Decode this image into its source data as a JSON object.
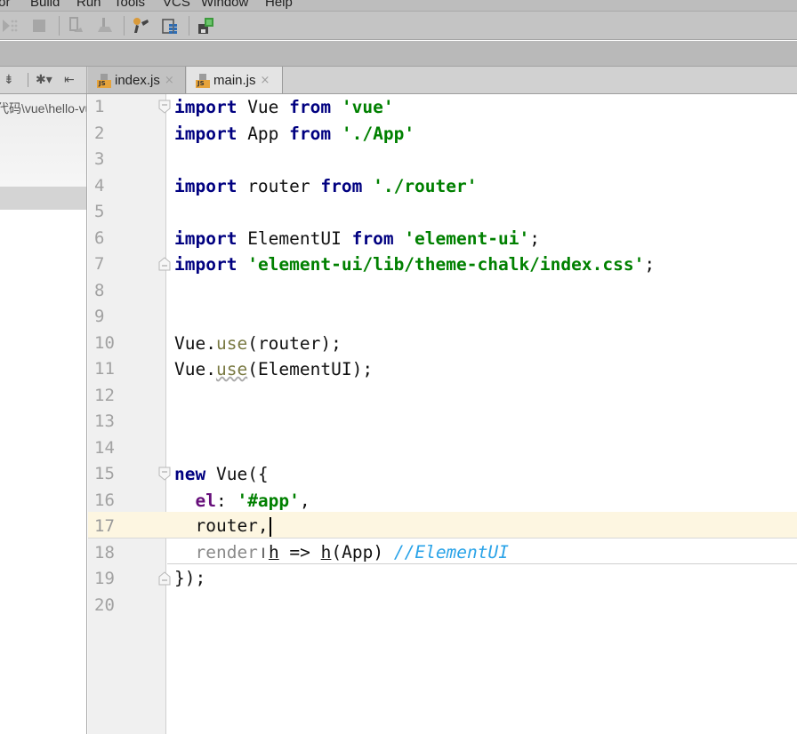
{
  "menubar": {
    "items": [
      {
        "label": "tor",
        "mnemonic": ""
      },
      {
        "label": "Build",
        "mnemonic": "B"
      },
      {
        "label": "Run",
        "mnemonic": "u"
      },
      {
        "label": "Tools",
        "mnemonic": "T"
      },
      {
        "label": "VCS",
        "mnemonic": "S"
      },
      {
        "label": "Window",
        "mnemonic": "W"
      },
      {
        "label": "Help",
        "mnemonic": "H"
      }
    ]
  },
  "toolbar": {
    "icons": [
      "debug-icon",
      "stop-icon",
      "attach-icon",
      "deploy-icon",
      "settings-wrench-icon",
      "project-structure-icon",
      "sdk-manager-icon"
    ]
  },
  "panel_tools": {
    "icons": [
      "collapse-all-icon",
      "gear-icon",
      "hide-panel-icon"
    ]
  },
  "tabs": [
    {
      "label": "index.js",
      "close": "×",
      "active": false,
      "file_type": "JS"
    },
    {
      "label": "main.js",
      "close": "×",
      "active": true,
      "file_type": "JS"
    }
  ],
  "project": {
    "path": "代码\\vue\\hello-vue"
  },
  "editor": {
    "current_line": 17,
    "line_numbers": [
      "1",
      "2",
      "3",
      "4",
      "5",
      "6",
      "7",
      "8",
      "9",
      "10",
      "11",
      "12",
      "13",
      "14",
      "15",
      "16",
      "17",
      "18",
      "19",
      "20"
    ],
    "lines": {
      "l1": {
        "kw1": "import",
        "t1": " Vue ",
        "kw2": "from",
        "sp": " ",
        "s1": "'vue'"
      },
      "l2": {
        "kw1": "import",
        "t1": " App ",
        "kw2": "from",
        "sp": " ",
        "s1": "'./App'"
      },
      "l4": {
        "kw1": "import",
        "t1": " router ",
        "kw2": "from",
        "sp": " ",
        "s1": "'./router'"
      },
      "l6": {
        "kw1": "import",
        "t1": " ElementUI ",
        "kw2": "from",
        "sp": " ",
        "s1": "'element-ui'",
        "end": ";"
      },
      "l7": {
        "kw1": "import",
        "sp": " ",
        "s1": "'element-ui/lib/theme-chalk/index.css'",
        "end": ";"
      },
      "l10": {
        "t1": "Vue.",
        "fn": "use",
        "t2": "(router);"
      },
      "l11": {
        "t1": "Vue.",
        "fn": "use",
        "t2": "(ElementUI);"
      },
      "l15": {
        "kw1": "new",
        "t1": " Vue({"
      },
      "l16": {
        "indent": "  ",
        "prop": "el",
        "t1": ": ",
        "s1": "'#app'",
        "end": ","
      },
      "l17": {
        "indent": "  ",
        "t1": "router,"
      },
      "l18": {
        "indent": "  ",
        "dim": "render",
        "p1": "h",
        "t1": " => ",
        "p2": "h",
        "t2": "(App) ",
        "cmt": "//ElementUI"
      },
      "l19": {
        "t1": "});"
      }
    }
  },
  "colors": {
    "keyword": "#000080",
    "string": "#008000",
    "comment": "#2aa3e8",
    "current_line": "#fdf6e1",
    "js_badge": "#e6a33b"
  }
}
